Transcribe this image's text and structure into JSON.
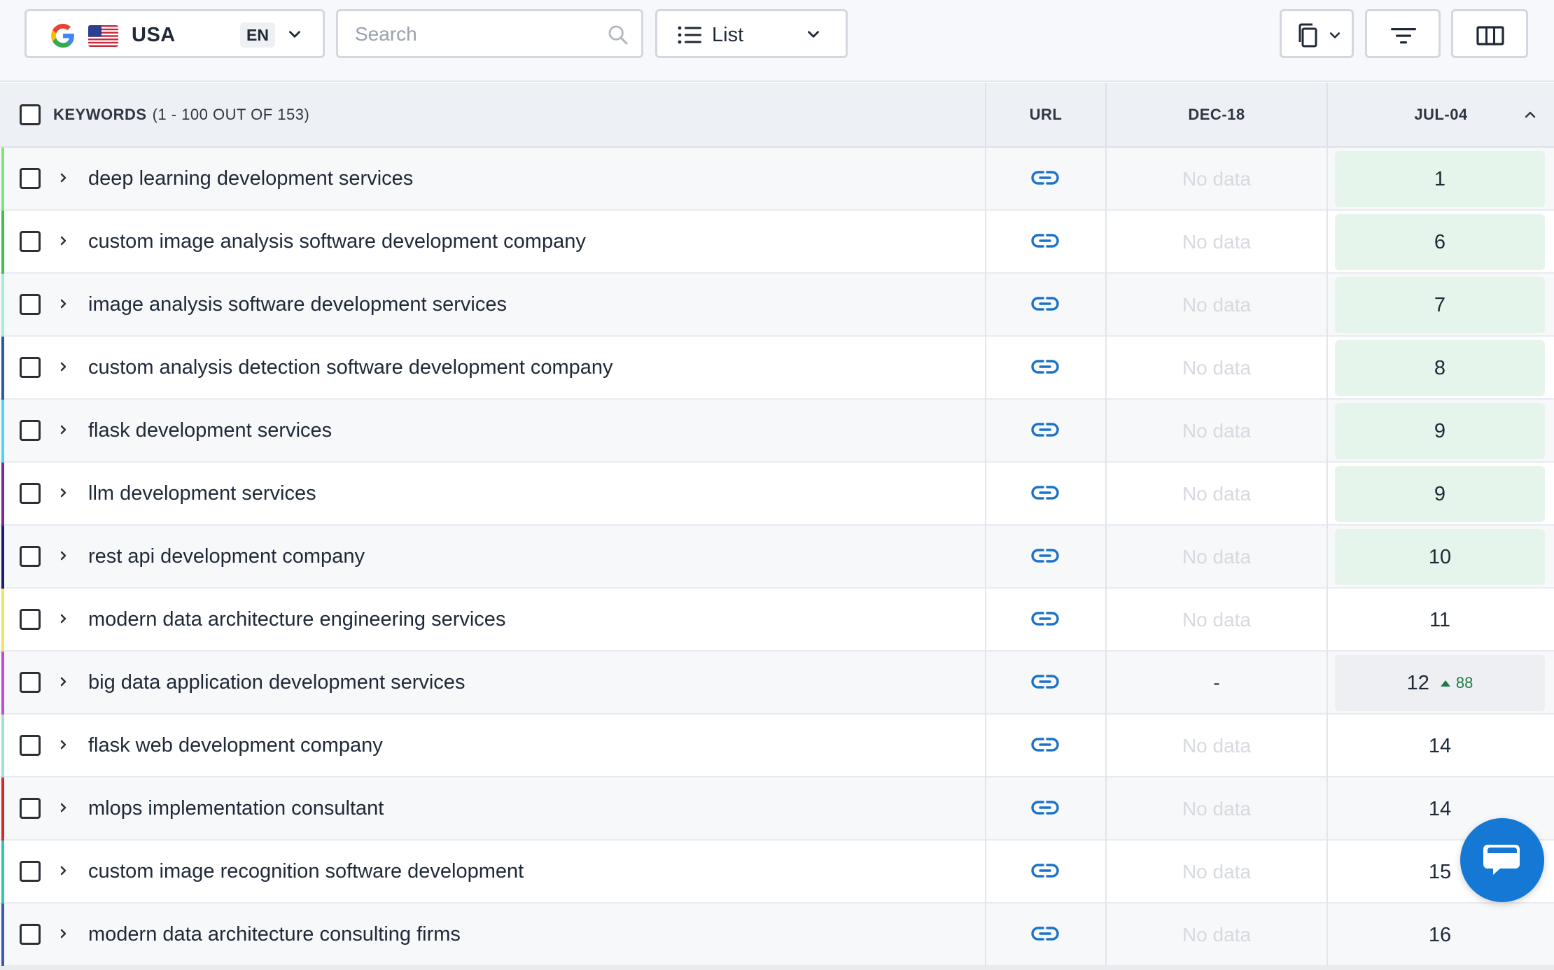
{
  "toolbar": {
    "country": "USA",
    "language": "EN",
    "search_placeholder": "Search",
    "view_label": "List",
    "icons": [
      "google-icon",
      "us-flag-icon",
      "chevron-down-icon",
      "search-icon",
      "list-icon",
      "copy-icon",
      "filter-icon",
      "columns-icon"
    ]
  },
  "table": {
    "headers": {
      "keywords": "KEYWORDS",
      "range": "(1 - 100 OUT OF 153)",
      "url": "URL",
      "date1": "DEC-18",
      "date2": "JUL-04"
    },
    "rows": [
      {
        "keyword": "deep learning development services",
        "dec18": "No data",
        "jul04": "1",
        "stripe": "#7ee37a"
      },
      {
        "keyword": "custom image analysis software development company",
        "dec18": "No data",
        "jul04": "6",
        "stripe": "#3fbf4f"
      },
      {
        "keyword": "image analysis software development services",
        "dec18": "No data",
        "jul04": "7",
        "stripe": "#a9ecd8"
      },
      {
        "keyword": "custom analysis detection software development company",
        "dec18": "No data",
        "jul04": "8",
        "stripe": "#2a57a8"
      },
      {
        "keyword": "flask development services",
        "dec18": "No data",
        "jul04": "9",
        "stripe": "#4dd6f0"
      },
      {
        "keyword": "llm development services",
        "dec18": "No data",
        "jul04": "9",
        "stripe": "#7b2b93"
      },
      {
        "keyword": "rest api development company",
        "dec18": "No data",
        "jul04": "10",
        "stripe": "#1c1e6e"
      },
      {
        "keyword": "modern data architecture engineering services",
        "dec18": "No data",
        "jul04": "11",
        "stripe": "#f2e36a"
      },
      {
        "keyword": "big data application development services",
        "dec18": "-",
        "jul04": "12",
        "jul04_change": "88",
        "stripe": "#c050c8"
      },
      {
        "keyword": "flask web development company",
        "dec18": "No data",
        "jul04": "14",
        "stripe": "#9fe2d4"
      },
      {
        "keyword": "mlops implementation consultant",
        "dec18": "No data",
        "jul04": "14",
        "stripe": "#d9262a"
      },
      {
        "keyword": "custom image recognition software development",
        "dec18": "No data",
        "jul04": "15",
        "stripe": "#2cc9b0"
      },
      {
        "keyword": "modern data architecture consulting firms",
        "dec18": "No data",
        "jul04": "16",
        "stripe": "#3a58b8"
      }
    ]
  },
  "colors": {
    "accent": "#1478d4",
    "top10_bg": "#e6f5ec",
    "link": "#1a73c9",
    "positive_change": "#1f7a4a"
  }
}
